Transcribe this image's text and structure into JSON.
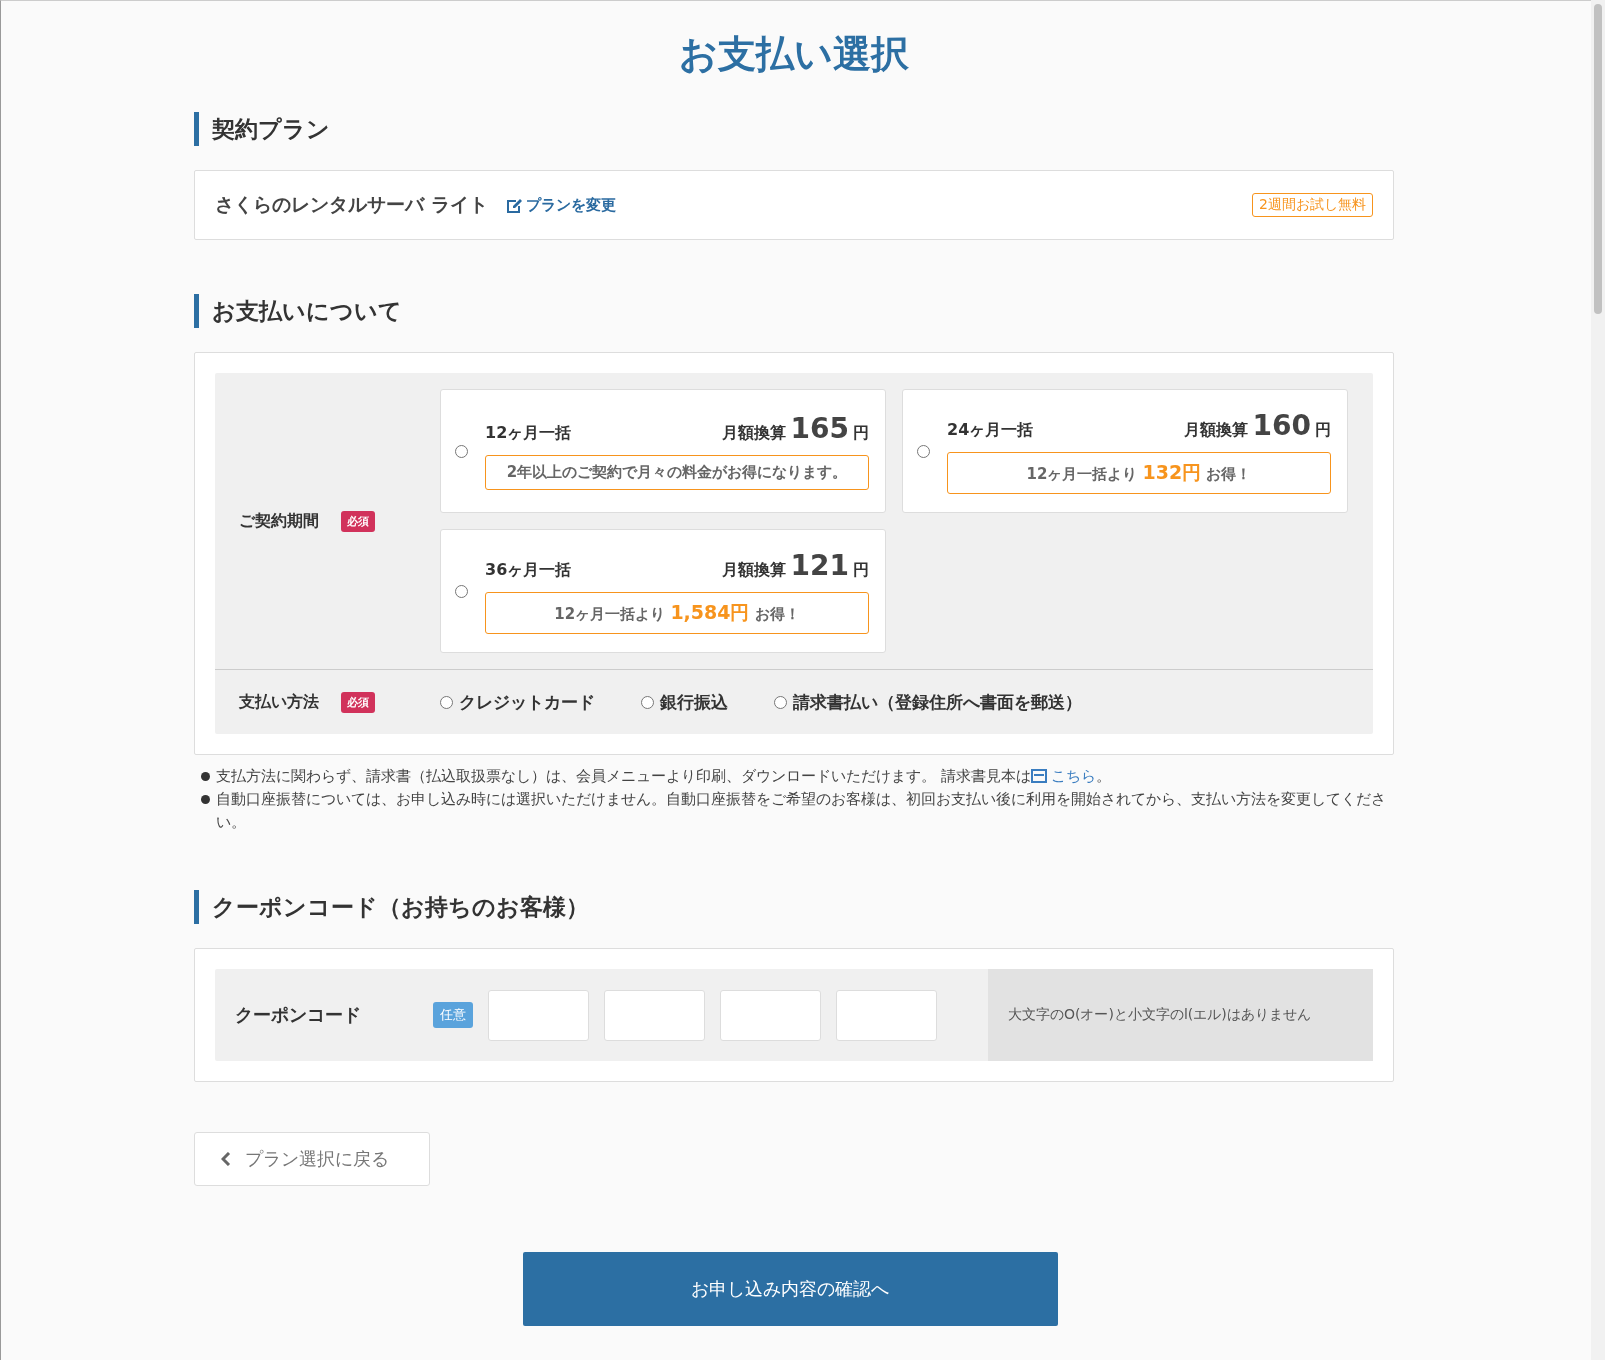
{
  "page_title": "お支払い選択",
  "plan_section": {
    "heading": "契約プラン",
    "plan_name": "さくらのレンタルサーバ ライト",
    "change_link": "プランを変更",
    "badge": "2週間お試し無料"
  },
  "payment_section": {
    "heading": "お支払いについて",
    "period": {
      "label": "ご契約期間",
      "required": "必須",
      "options": [
        {
          "name": "12ヶ月一括",
          "monthly_label": "月額換算",
          "price": "165",
          "unit": "円",
          "note": "2年以上のご契約で月々の料金がお得になります。",
          "selected": false
        },
        {
          "name": "24ヶ月一括",
          "monthly_label": "月額換算",
          "price": "160",
          "unit": "円",
          "note": "12ヶ月一括より **132円** お得！",
          "selected": false
        },
        {
          "name": "36ヶ月一括",
          "monthly_label": "月額換算",
          "price": "121",
          "unit": "円",
          "note": "12ヶ月一括より **1,584円** お得！",
          "selected": false
        }
      ]
    },
    "method": {
      "label": "支払い方法",
      "required": "必須",
      "options": [
        {
          "label": "クレジットカード",
          "selected": false
        },
        {
          "label": "銀行振込",
          "selected": false
        },
        {
          "label": "請求書払い（登録住所へ書面を郵送）",
          "selected": false
        }
      ]
    },
    "notes": [
      {
        "text": "支払方法に関わらず、請求書（払込取扱票なし）は、会員メニューより印刷、ダウンロードいただけます。 請求書見本は",
        "link": "こちら",
        "after": "。"
      },
      {
        "text": "自動口座振替については、お申し込み時には選択いただけません。自動口座振替をご希望のお客様は、初回お支払い後に利用を開始されてから、支払い方法を変更してください。"
      }
    ]
  },
  "coupon_section": {
    "heading": "クーポンコード（お持ちのお客様）",
    "label": "クーポンコード",
    "optional": "任意",
    "hint": "大文字のO(オー)と小文字のl(エル)はありません"
  },
  "back_button": "プラン選択に戻る",
  "submit_button": "お申し込み内容の確認へ"
}
